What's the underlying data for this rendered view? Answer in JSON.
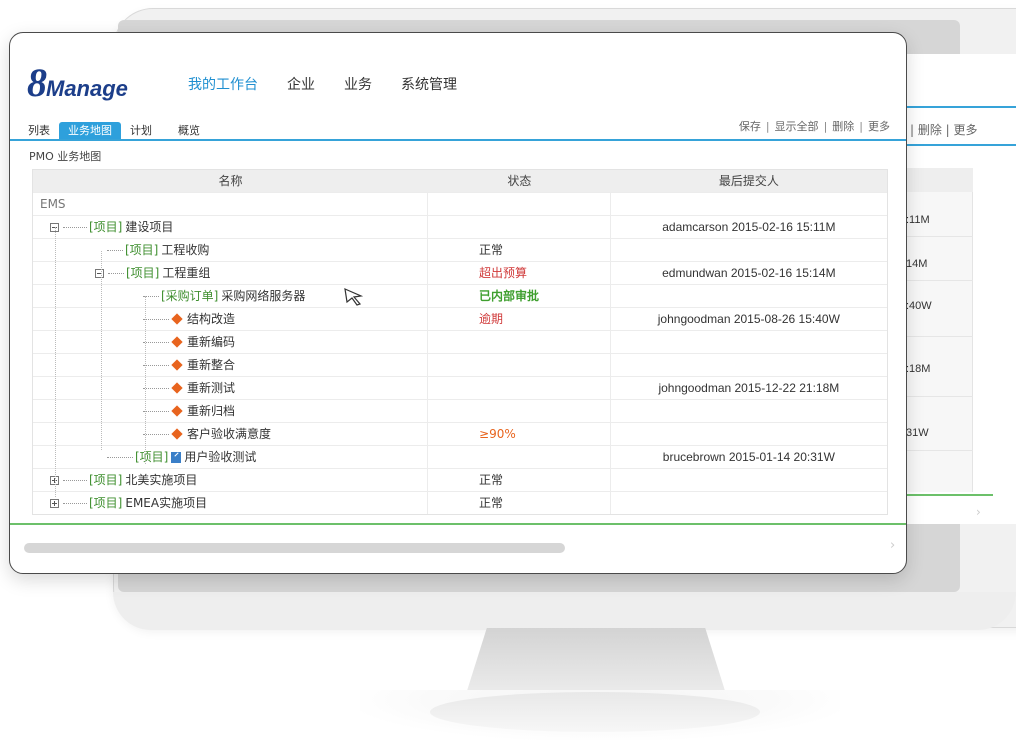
{
  "app": {
    "logo_num": "8",
    "logo_text": "Manage"
  },
  "nav": {
    "items": [
      {
        "label": "我的工作台",
        "active": true
      },
      {
        "label": "企业",
        "active": false
      },
      {
        "label": "业务",
        "active": false
      },
      {
        "label": "系统管理",
        "active": false
      }
    ]
  },
  "subtabs": [
    {
      "label": "列表",
      "active": false
    },
    {
      "label": "业务地图",
      "active": true
    },
    {
      "label": "计划",
      "active": false
    },
    {
      "label": "概览",
      "active": false
    }
  ],
  "toolbar": {
    "save": "保存",
    "show_all": "显示全部",
    "delete": "删除",
    "more": "更多",
    "sep": "|"
  },
  "section_title": "PMO 业务地图",
  "table": {
    "headers": [
      "名称",
      "状态",
      "最后提交人"
    ],
    "rows": [
      {
        "tag": "",
        "name": "EMS",
        "status": "",
        "submitter": ""
      },
      {
        "tag": "[项目]",
        "name": "建设项目",
        "status": "",
        "submitter": "adamcarson 2015-02-16 15:11M"
      },
      {
        "tag": "[项目]",
        "name": "工程收购",
        "status": "正常",
        "submitter": ""
      },
      {
        "tag": "[项目]",
        "name": "工程重组",
        "status": "超出预算",
        "submitter": "edmundwan 2015-02-16 15:14M"
      },
      {
        "tag": "[采购订单]",
        "name": "采购网络服务器",
        "status": "已内部审批",
        "submitter": ""
      },
      {
        "tag": "",
        "name": "结构改造",
        "status": "逾期",
        "submitter": "johngoodman 2015-08-26 15:40W"
      },
      {
        "tag": "",
        "name": "重新编码",
        "status": "",
        "submitter": ""
      },
      {
        "tag": "",
        "name": "重新整合",
        "status": "",
        "submitter": ""
      },
      {
        "tag": "",
        "name": "重新测试",
        "status": "",
        "submitter": "johngoodman 2015-12-22 21:18M"
      },
      {
        "tag": "",
        "name": "重新归档",
        "status": "",
        "submitter": ""
      },
      {
        "tag": "",
        "name": "客户验收满意度",
        "status": "≥90%",
        "submitter": ""
      },
      {
        "tag": "[项目]",
        "name": "用户验收测试",
        "status": "",
        "submitter": "brucebrown 2015-01-14 20:31W"
      },
      {
        "tag": "[项目]",
        "name": "北美实施项目",
        "status": "正常",
        "submitter": ""
      },
      {
        "tag": "[项目]",
        "name": "EMEA实施项目",
        "status": "正常",
        "submitter": ""
      }
    ]
  },
  "bg_monitor": {
    "toolbar": "| 删除 | 更多",
    "cells": [
      ":11M",
      "14M",
      ":40W",
      ":18M",
      "31W"
    ]
  },
  "colors": {
    "accent": "#2ea0dc",
    "tag_green": "#3f8f2f",
    "status_red": "#d03a3a",
    "diamond_orange": "#e8641e",
    "logo_blue": "#1c3e8a"
  }
}
